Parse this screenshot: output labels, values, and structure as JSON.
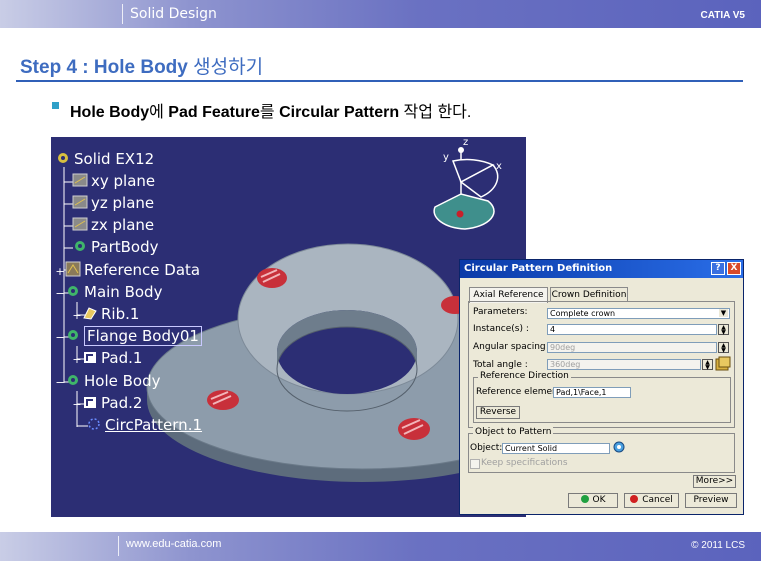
{
  "header": {
    "title": "Solid Design",
    "brand": "CATIA V5"
  },
  "step": {
    "prefix": "Step 4 : Hole Body",
    "suffix": "생성하기"
  },
  "bullet": {
    "p1": "Hole Body",
    "p2": "에 ",
    "p3": "Pad Feature",
    "p4": "를 ",
    "p5": "Circular Pattern",
    "p6": " 작업 한다."
  },
  "tree": {
    "items": [
      {
        "label": "Solid EX12"
      },
      {
        "label": "xy plane"
      },
      {
        "label": "yz plane"
      },
      {
        "label": "zx plane"
      },
      {
        "label": "PartBody"
      },
      {
        "label": "Reference Data"
      },
      {
        "label": "Main Body"
      },
      {
        "label": "Rib.1"
      },
      {
        "label": "Flange Body01"
      },
      {
        "label": "Pad.1"
      },
      {
        "label": "Hole Body"
      },
      {
        "label": "Pad.2"
      },
      {
        "label": "CircPattern.1"
      }
    ]
  },
  "compass": {
    "x": "x",
    "y": "y",
    "z": "z"
  },
  "dialog": {
    "title": "Circular Pattern Definition",
    "help": "?",
    "close": "X",
    "tabs": [
      "Axial Reference",
      "Crown Definition"
    ],
    "parameters_label": "Parameters:",
    "parameters_value": "Complete crown",
    "instances_label": "Instance(s) :",
    "instances_value": "4",
    "angular_label": "Angular spacing :",
    "angular_value": "90deg",
    "total_label": "Total angle :",
    "total_value": "360deg",
    "refdir_title": "Reference Direction",
    "refelem_label": "Reference element:",
    "refelem_value": "Pad,1\\Face,1",
    "reverse": "Reverse",
    "obj_title": "Object to Pattern",
    "object_label": "Object:",
    "object_value": "Current Solid",
    "keep_spec": "Keep specifications",
    "more": "More>>",
    "ok": "OK",
    "cancel": "Cancel",
    "preview": "Preview"
  },
  "footer": {
    "url": "www.edu-catia.com",
    "copyright": "© 2011 LCS"
  }
}
